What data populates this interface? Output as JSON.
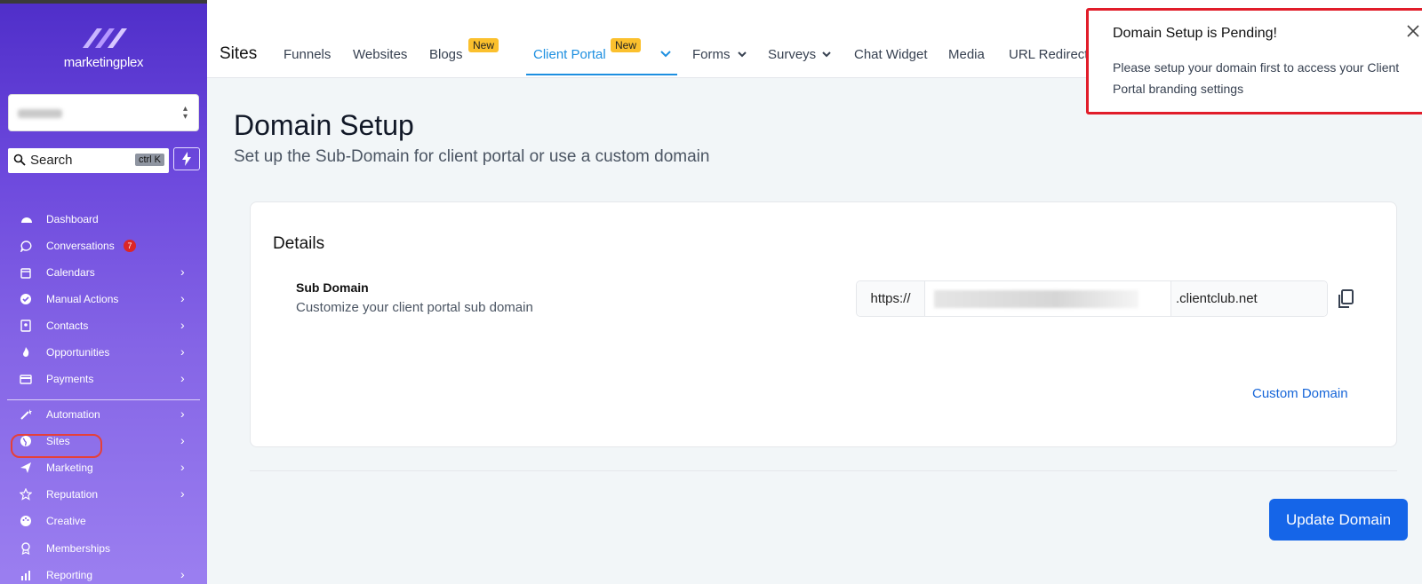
{
  "brand": {
    "name": "marketingplex"
  },
  "account_switcher": {
    "value": ""
  },
  "search": {
    "placeholder": "Search",
    "shortcut": "ctrl K"
  },
  "sidebar": {
    "items": [
      {
        "label": "Dashboard",
        "icon": "dashboard-icon"
      },
      {
        "label": "Conversations",
        "icon": "chat-icon",
        "badge": "7"
      },
      {
        "label": "Calendars",
        "icon": "calendar-icon"
      },
      {
        "label": "Manual Actions",
        "icon": "check-circle-icon"
      },
      {
        "label": "Contacts",
        "icon": "contacts-icon"
      },
      {
        "label": "Opportunities",
        "icon": "flame-icon"
      },
      {
        "label": "Payments",
        "icon": "card-icon"
      },
      {
        "label": "Automation",
        "icon": "wand-icon"
      },
      {
        "label": "Sites",
        "icon": "globe-icon"
      },
      {
        "label": "Marketing",
        "icon": "send-icon"
      },
      {
        "label": "Reputation",
        "icon": "star-icon"
      },
      {
        "label": "Creative",
        "icon": "palette-icon"
      },
      {
        "label": "Memberships",
        "icon": "award-icon"
      },
      {
        "label": "Reporting",
        "icon": "chart-icon"
      }
    ]
  },
  "topnav": {
    "section": "Sites",
    "tabs": [
      "Funnels",
      "Websites",
      "Blogs",
      "Client Portal",
      "Forms",
      "Surveys",
      "Chat Widget",
      "Media",
      "URL Redirects"
    ],
    "new_label": "New",
    "active_tab": "Client Portal"
  },
  "main": {
    "title": "Domain Setup",
    "subtitle": "Set up the Sub-Domain for client portal or use a custom domain",
    "details_heading": "Details",
    "subdomain_label": "Sub Domain",
    "subdomain_help": "Customize your client portal sub domain",
    "prefix": "https://",
    "subdomain_value": "",
    "suffix": ".clientclub.net",
    "custom_domain_link": "Custom Domain",
    "update_button": "Update Domain"
  },
  "toast": {
    "title": "Domain Setup is Pending!",
    "body": "Please setup your domain first to access your Client Portal branding settings"
  },
  "colors": {
    "accent": "#1d8fe0",
    "primary_button": "#1565e8",
    "alert_border": "#e11d2a",
    "badge": "#dc2626"
  }
}
